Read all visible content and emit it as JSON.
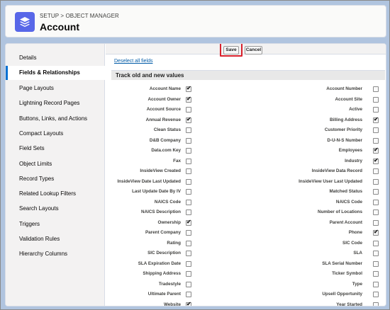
{
  "header": {
    "breadcrumb": "SETUP > OBJECT MANAGER",
    "title": "Account",
    "icon": "stacked-layers-icon",
    "icon_color": "#5867e8"
  },
  "sidebar": {
    "active_color": "#0070d2",
    "items": [
      {
        "label": "Details",
        "active": false
      },
      {
        "label": "Fields & Relationships",
        "active": true
      },
      {
        "label": "Page Layouts",
        "active": false
      },
      {
        "label": "Lightning Record Pages",
        "active": false
      },
      {
        "label": "Buttons, Links, and Actions",
        "active": false
      },
      {
        "label": "Compact Layouts",
        "active": false
      },
      {
        "label": "Field Sets",
        "active": false
      },
      {
        "label": "Object Limits",
        "active": false
      },
      {
        "label": "Record Types",
        "active": false
      },
      {
        "label": "Related Lookup Filters",
        "active": false
      },
      {
        "label": "Search Layouts",
        "active": false
      },
      {
        "label": "Triggers",
        "active": false
      },
      {
        "label": "Validation Rules",
        "active": false
      },
      {
        "label": "Hierarchy Columns",
        "active": false
      }
    ]
  },
  "toolbar": {
    "save_label": "Save",
    "cancel_label": "Cancel",
    "highlight_color": "#d9212c"
  },
  "main": {
    "deselect_label": "Deselect all fields",
    "section_title": "Track old and new values",
    "rows": [
      {
        "left": {
          "label": "Account Name",
          "checked": true
        },
        "right": {
          "label": "Account Number",
          "checked": false
        }
      },
      {
        "left": {
          "label": "Account Owner",
          "checked": true
        },
        "right": {
          "label": "Account Site",
          "checked": false
        }
      },
      {
        "left": {
          "label": "Account Source",
          "checked": false
        },
        "right": {
          "label": "Active",
          "checked": false
        }
      },
      {
        "left": {
          "label": "Annual Revenue",
          "checked": true
        },
        "right": {
          "label": "Billing Address",
          "checked": true
        }
      },
      {
        "left": {
          "label": "Clean Status",
          "checked": false
        },
        "right": {
          "label": "Customer Priority",
          "checked": false
        }
      },
      {
        "left": {
          "label": "D&B Company",
          "checked": false
        },
        "right": {
          "label": "D-U-N-S Number",
          "checked": false
        }
      },
      {
        "left": {
          "label": "Data.com Key",
          "checked": false
        },
        "right": {
          "label": "Employees",
          "checked": true
        }
      },
      {
        "left": {
          "label": "Fax",
          "checked": false
        },
        "right": {
          "label": "Industry",
          "checked": true
        }
      },
      {
        "left": {
          "label": "InsideView Created",
          "checked": false
        },
        "right": {
          "label": "InsideView Data Record",
          "checked": false
        }
      },
      {
        "left": {
          "label": "InsideView Date Last Updated",
          "checked": false
        },
        "right": {
          "label": "InsideView User Last Updated",
          "checked": false
        }
      },
      {
        "left": {
          "label": "Last Update Date By IV",
          "checked": false
        },
        "right": {
          "label": "Matched Status",
          "checked": false
        }
      },
      {
        "left": {
          "label": "NAICS Code",
          "checked": false
        },
        "right": {
          "label": "NAICS Code",
          "checked": false
        }
      },
      {
        "left": {
          "label": "NAICS Description",
          "checked": false
        },
        "right": {
          "label": "Number of Locations",
          "checked": false
        }
      },
      {
        "left": {
          "label": "Ownership",
          "checked": true
        },
        "right": {
          "label": "Parent Account",
          "checked": false
        }
      },
      {
        "left": {
          "label": "Parent Company",
          "checked": false
        },
        "right": {
          "label": "Phone",
          "checked": true
        }
      },
      {
        "left": {
          "label": "Rating",
          "checked": false
        },
        "right": {
          "label": "SIC Code",
          "checked": false
        }
      },
      {
        "left": {
          "label": "SIC Description",
          "checked": false
        },
        "right": {
          "label": "SLA",
          "checked": false
        }
      },
      {
        "left": {
          "label": "SLA Expiration Date",
          "checked": false
        },
        "right": {
          "label": "SLA Serial Number",
          "checked": false
        }
      },
      {
        "left": {
          "label": "Shipping Address",
          "checked": false
        },
        "right": {
          "label": "Ticker Symbol",
          "checked": false
        }
      },
      {
        "left": {
          "label": "Tradestyle",
          "checked": false
        },
        "right": {
          "label": "Type",
          "checked": false
        }
      },
      {
        "left": {
          "label": "Ultimate Parent",
          "checked": false
        },
        "right": {
          "label": "Upsell Opportunity",
          "checked": false
        }
      },
      {
        "left": {
          "label": "Website",
          "checked": true
        },
        "right": {
          "label": "Year Started",
          "checked": false
        }
      }
    ]
  }
}
